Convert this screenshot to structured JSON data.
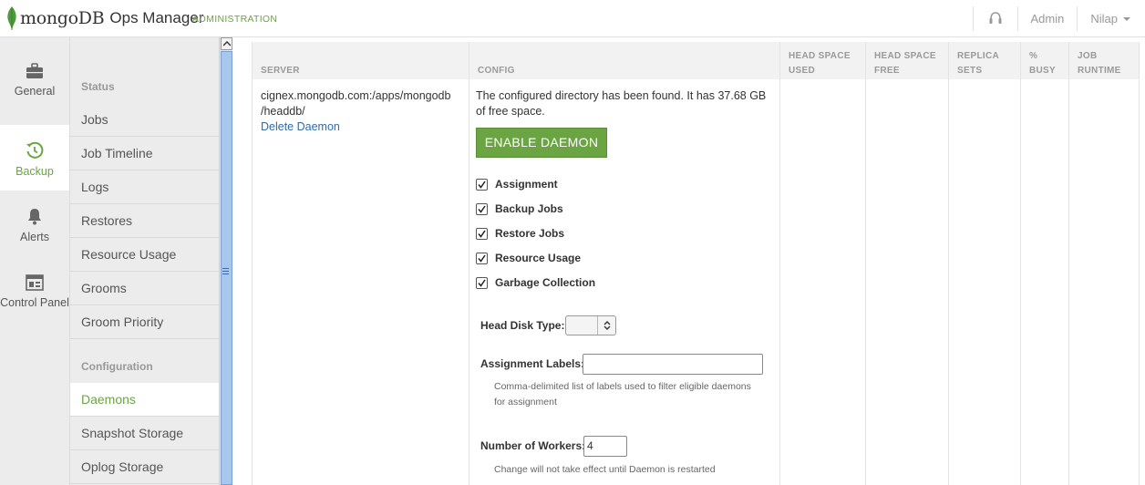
{
  "header": {
    "brand_mongo": "mongo",
    "brand_db": "DB",
    "product": "Ops Manager",
    "section": "ADMINISTRATION",
    "admin_link": "Admin",
    "user": "Nilap"
  },
  "rail": {
    "items": [
      {
        "label": "General",
        "icon": "briefcase-icon"
      },
      {
        "label": "Backup",
        "icon": "history-icon"
      },
      {
        "label": "Alerts",
        "icon": "bell-icon"
      },
      {
        "label": "Control Panel",
        "icon": "dashboard-icon"
      }
    ],
    "active": "Backup"
  },
  "subnav": {
    "status_heading": "Status",
    "status_items": [
      "Jobs",
      "Job Timeline",
      "Logs",
      "Restores",
      "Resource Usage",
      "Grooms",
      "Groom Priority"
    ],
    "config_heading": "Configuration",
    "config_items": [
      "Daemons",
      "Snapshot Storage",
      "Oplog Storage"
    ],
    "active": "Daemons"
  },
  "table": {
    "headers": {
      "server": "SERVER",
      "config": "CONFIG",
      "head_used_1": "HEAD SPACE",
      "head_used_2": "USED",
      "head_free_1": "HEAD SPACE",
      "head_free_2": "FREE",
      "replica_1": "REPLICA",
      "replica_2": "SETS",
      "busy_1": "%",
      "busy_2": "BUSY",
      "runtime_1": "JOB",
      "runtime_2": "RUNTIME"
    },
    "row": {
      "server_line1": "cignex.mongodb.com:/apps/mongodb",
      "server_line2": "/headdb/",
      "delete_link": "Delete Daemon",
      "found_text": "The configured directory has been found. It has 37.68 GB of free space.",
      "enable_button": "ENABLE DAEMON",
      "checkboxes": [
        {
          "label": "Assignment",
          "checked": true
        },
        {
          "label": "Backup Jobs",
          "checked": true
        },
        {
          "label": "Restore Jobs",
          "checked": true
        },
        {
          "label": "Resource Usage",
          "checked": true
        },
        {
          "label": "Garbage Collection",
          "checked": true
        }
      ],
      "head_disk_label": "Head Disk Type:",
      "head_disk_value": "",
      "assignment_labels_label": "Assignment Labels:",
      "assignment_labels_value": "",
      "assignment_help": "Comma-delimited list of labels used to filter eligible daemons for assignment",
      "workers_label": "Number of Workers:",
      "workers_value": "4",
      "workers_help": "Change will not take effect until Daemon is restarted"
    }
  },
  "colors": {
    "accent": "#6ba442",
    "link": "#2b6cb0"
  }
}
